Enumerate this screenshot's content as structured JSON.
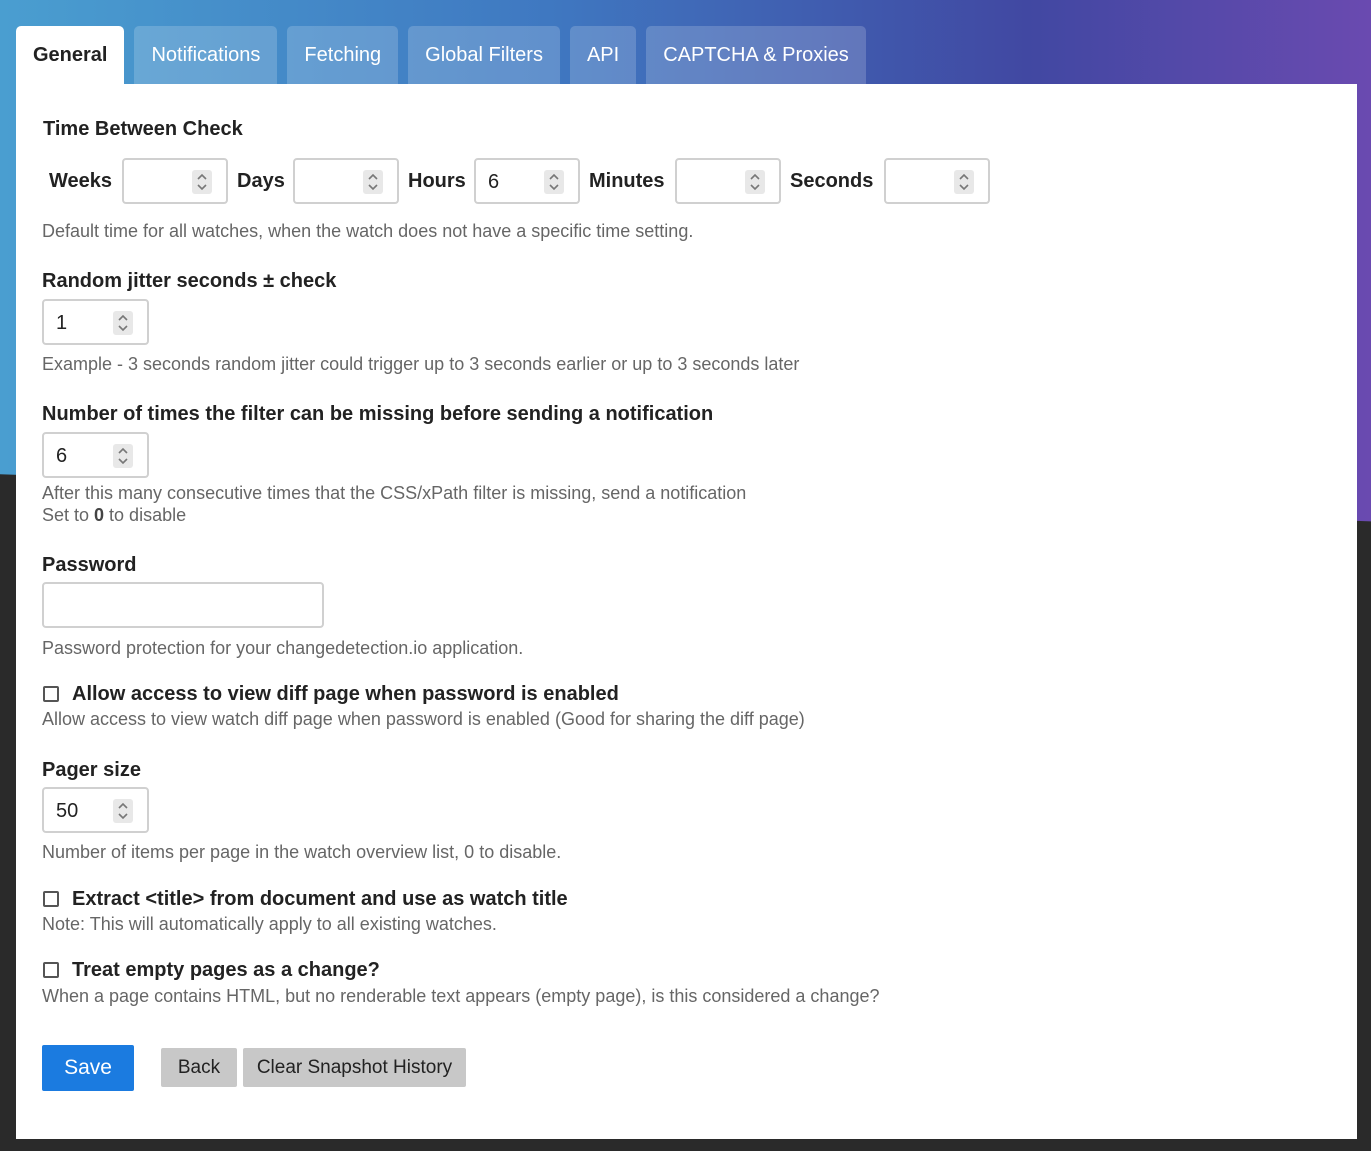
{
  "tabs": [
    {
      "label": "General",
      "active": true
    },
    {
      "label": "Notifications"
    },
    {
      "label": "Fetching"
    },
    {
      "label": "Global Filters"
    },
    {
      "label": "API"
    },
    {
      "label": "CAPTCHA & Proxies"
    }
  ],
  "time_between_check": {
    "title": "Time Between Check",
    "weeks_label": "Weeks",
    "weeks_value": "",
    "days_label": "Days",
    "days_value": "",
    "hours_label": "Hours",
    "hours_value": "6",
    "minutes_label": "Minutes",
    "minutes_value": "",
    "seconds_label": "Seconds",
    "seconds_value": "",
    "help": "Default time for all watches, when the watch does not have a specific time setting."
  },
  "jitter": {
    "label": "Random jitter seconds ± check",
    "value": "1",
    "help": "Example - 3 seconds random jitter could trigger up to 3 seconds earlier or up to 3 seconds later"
  },
  "filter_missing": {
    "label": "Number of times the filter can be missing before sending a notification",
    "value": "6",
    "help_line1": "After this many consecutive times that the CSS/xPath filter is missing, send a notification",
    "help_line2_prefix": "Set to ",
    "help_line2_bold": "0",
    "help_line2_suffix": " to disable"
  },
  "password": {
    "label": "Password",
    "value": "",
    "help": "Password protection for your changedetection.io application."
  },
  "allow_diff": {
    "label": "Allow access to view diff page when password is enabled",
    "checked": false,
    "help": "Allow access to view watch diff page when password is enabled (Good for sharing the diff page)"
  },
  "pager": {
    "label": "Pager size",
    "value": "50",
    "help": "Number of items per page in the watch overview list, 0 to disable."
  },
  "extract_title": {
    "label": "Extract <title> from document and use as watch title",
    "checked": false,
    "help": "Note: This will automatically apply to all existing watches."
  },
  "empty_pages": {
    "label": "Treat empty pages as a change?",
    "checked": false,
    "help": "When a page contains HTML, but no renderable text appears (empty page), is this considered a change?"
  },
  "buttons": {
    "save": "Save",
    "back": "Back",
    "clear": "Clear Snapshot History"
  },
  "colors": {
    "primary": "#1b7be0",
    "secondary": "#c8c8c8",
    "gradient_start": "#4a9ed0",
    "gradient_end": "#6a4ab0"
  }
}
